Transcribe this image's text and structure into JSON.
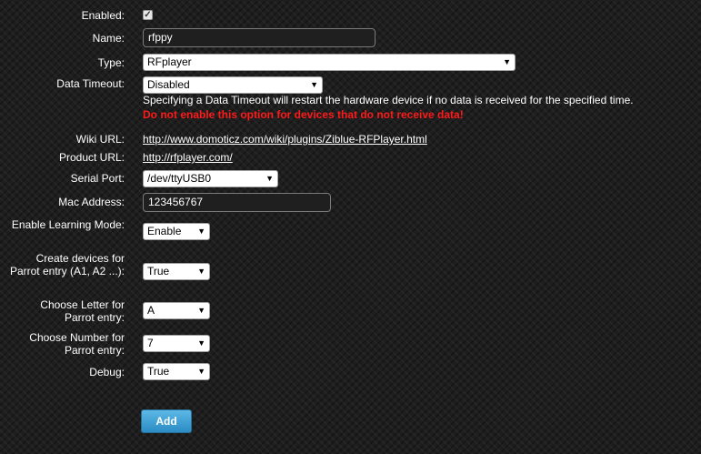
{
  "form": {
    "enabled_label": "Enabled:",
    "enabled_checked": true,
    "check_mark": "✓",
    "name_label": "Name:",
    "name_value": "rfppy",
    "type_label": "Type:",
    "type_value": "RFplayer",
    "timeout_label": "Data Timeout:",
    "timeout_value": "Disabled",
    "timeout_description": "Specifying a Data Timeout will restart the hardware device if no data is received for the specified time.",
    "timeout_warning": "Do not enable this option for devices that do not receive data!",
    "wiki_label": "Wiki URL:",
    "wiki_value": "http://www.domoticz.com/wiki/plugins/Ziblue-RFPlayer.html",
    "product_label": "Product URL:",
    "product_value": "http://rfplayer.com/",
    "serial_label": "Serial Port:",
    "serial_value": "/dev/ttyUSB0",
    "mac_label": "Mac Address:",
    "mac_value": "123456767",
    "learning_label": "Enable Learning Mode:",
    "learning_value": "Enable",
    "parrot_create_label": "Create devices for Parrot entry (A1, A2 ...):",
    "parrot_create_value": "True",
    "parrot_letter_label": "Choose Letter for Parrot entry:",
    "parrot_letter_value": "A",
    "parrot_number_label": "Choose Number for Parrot entry:",
    "parrot_number_value": "7",
    "debug_label": "Debug:",
    "debug_value": "True",
    "add_label": "Add",
    "caret": "▼"
  },
  "colors": {
    "warning": "#ff1a1a",
    "button_top": "#5cb8e6",
    "button_bottom": "#2b8cc4"
  },
  "icons": {
    "dropdown": "chevron-down-icon",
    "checkbox": "checkmark-icon"
  }
}
